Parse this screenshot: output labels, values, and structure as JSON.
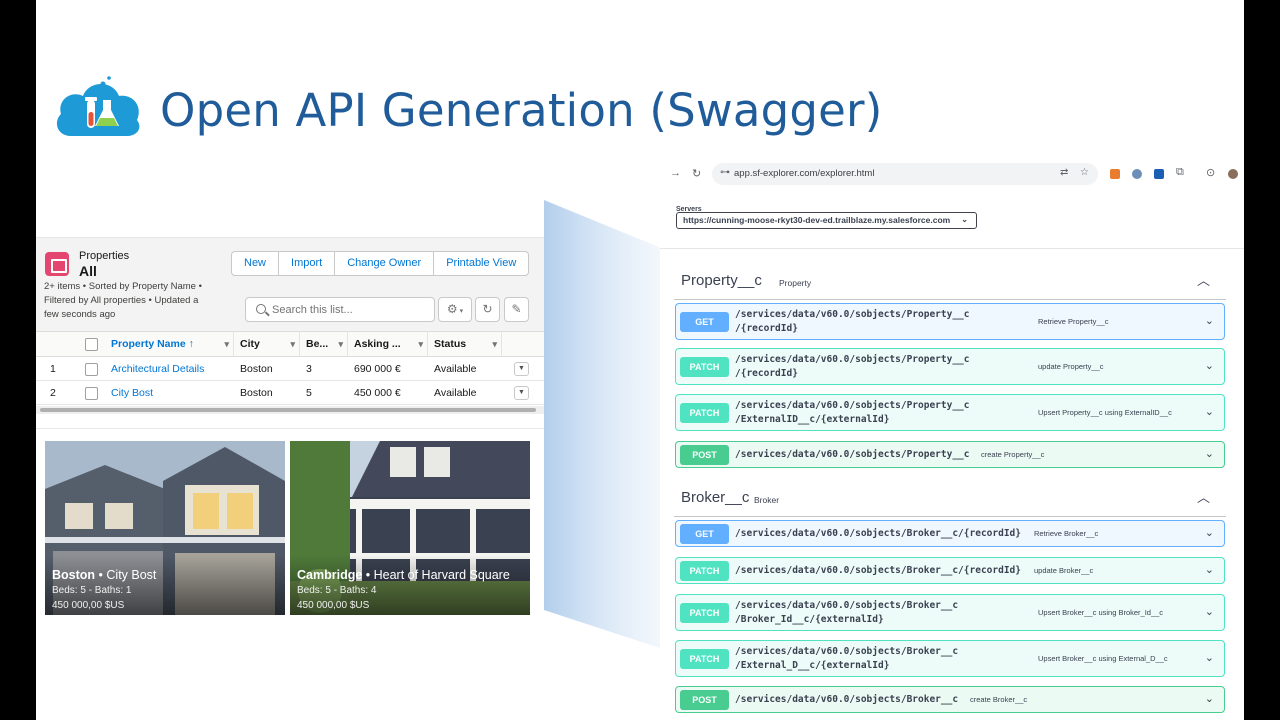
{
  "slide": {
    "title": "Open API Generation (Swagger)"
  },
  "salesforce": {
    "object_label": "Properties",
    "view_name": "All",
    "summary_line1": "2+ items • Sorted by Property Name •",
    "summary_line2": "Filtered by All properties • Updated a",
    "summary_line3": "few seconds ago",
    "buttons": [
      "New",
      "Import",
      "Change Owner",
      "Printable View"
    ],
    "search_placeholder": "Search this list...",
    "columns": [
      "Property Name",
      "City",
      "Be...",
      "Asking ...",
      "Status"
    ],
    "sort_indicator": "↑",
    "rows": [
      {
        "num": "1",
        "name": "Architectural Details",
        "city": "Boston",
        "beds": "3",
        "price": "690 000 €",
        "status": "Available"
      },
      {
        "num": "2",
        "name": "City Bost",
        "city": "Boston",
        "beds": "5",
        "price": "450 000 €",
        "status": "Available"
      }
    ],
    "cards": [
      {
        "city": "Boston",
        "name": "City Bost",
        "beds": "Beds: 5 - Baths: 1",
        "price": "450 000,00 $US"
      },
      {
        "city": "Cambridge",
        "name": "Heart of Harvard Square",
        "beds": "Beds: 5 - Baths: 4",
        "price": "450 000,00 $US"
      }
    ]
  },
  "swagger": {
    "url": "app.sf-explorer.com/explorer.html",
    "servers_label": "Servers",
    "server": "https://cunning-moose-rkyt30-dev-ed.trailblaze.my.salesforce.com",
    "tags": [
      {
        "name": "Property__c",
        "desc": "Property",
        "ops": [
          {
            "method": "GET",
            "path1": "/services/data/v60.0/sobjects/Property__c",
            "path2": "/{recordId}",
            "desc": "Retrieve Property__c"
          },
          {
            "method": "PATCH",
            "path1": "/services/data/v60.0/sobjects/Property__c",
            "path2": "/{recordId}",
            "desc": "update Property__c"
          },
          {
            "method": "PATCH",
            "path1": "/services/data/v60.0/sobjects/Property__c",
            "path2": "/ExternalID__c/{externalId}",
            "desc": "Upsert Property__c using ExternalID__c"
          },
          {
            "method": "POST",
            "path1": "/services/data/v60.0/sobjects/Property__c",
            "path2": "",
            "desc": "create Property__c"
          }
        ]
      },
      {
        "name": "Broker__c",
        "desc": "Broker",
        "ops": [
          {
            "method": "GET",
            "path1": "/services/data/v60.0/sobjects/Broker__c/{recordId}",
            "path2": "",
            "desc": "Retrieve Broker__c"
          },
          {
            "method": "PATCH",
            "path1": "/services/data/v60.0/sobjects/Broker__c/{recordId}",
            "path2": "",
            "desc": "update Broker__c"
          },
          {
            "method": "PATCH",
            "path1": "/services/data/v60.0/sobjects/Broker__c",
            "path2": "/Broker_Id__c/{externalId}",
            "desc": "Upsert Broker__c using Broker_Id__c"
          },
          {
            "method": "PATCH",
            "path1": "/services/data/v60.0/sobjects/Broker__c",
            "path2": "/External_D__c/{externalId}",
            "desc": "Upsert Broker__c using External_D__c"
          },
          {
            "method": "POST",
            "path1": "/services/data/v60.0/sobjects/Broker__c",
            "path2": "",
            "desc": "create Broker__c"
          }
        ]
      }
    ]
  },
  "colors": {
    "title": "#1f5c99",
    "sf_link": "#0176d3",
    "get": "#61affe",
    "patch": "#50e3c2",
    "post": "#49cc90"
  }
}
